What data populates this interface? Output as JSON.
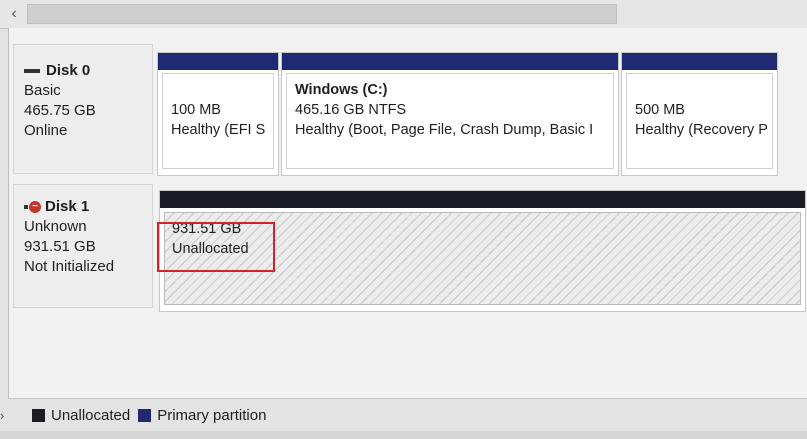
{
  "scrollbar": {
    "arrow": "‹"
  },
  "disks": [
    {
      "name": "Disk 0",
      "type": "Basic",
      "size": "465.75 GB",
      "status": "Online",
      "icon": "disk-icon",
      "partitions": [
        {
          "size": "100 MB",
          "status": "Healthy (EFI S"
        },
        {
          "name": "Windows  (C:)",
          "size": "465.16 GB NTFS",
          "status": "Healthy (Boot, Page File, Crash Dump, Basic I"
        },
        {
          "size": "500 MB",
          "status": "Healthy (Recovery P"
        }
      ]
    },
    {
      "name": "Disk 1",
      "type": "Unknown",
      "size": "931.51 GB",
      "status": "Not Initialized",
      "icon": "disk-not-initialized-icon",
      "unallocated": {
        "size": "931.51 GB",
        "label": "Unallocated"
      }
    }
  ],
  "legend": {
    "unallocated": "Unallocated",
    "primary": "Primary partition"
  },
  "colors": {
    "primary": "#1f2a72",
    "unallocated": "#1c1c24",
    "highlight": "#d4222a"
  }
}
